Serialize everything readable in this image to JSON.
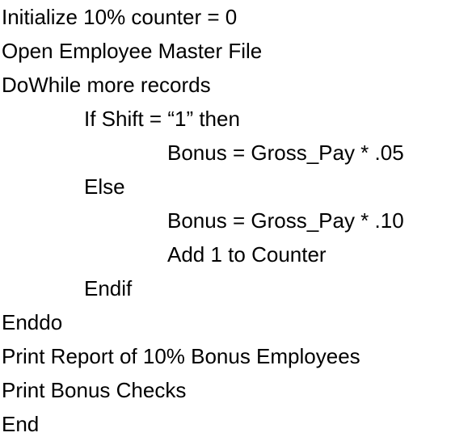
{
  "pseudocode": {
    "lines": [
      "Initialize 10% counter = 0",
      "Open Employee Master File",
      "DoWhile more records",
      "If Shift = “1” then",
      "Bonus = Gross_Pay * .05",
      "Else",
      "Bonus = Gross_Pay * .10",
      "Add 1 to Counter",
      "Endif",
      "Enddo",
      "Print Report of 10% Bonus Employees",
      "Print Bonus Checks",
      "End"
    ]
  }
}
